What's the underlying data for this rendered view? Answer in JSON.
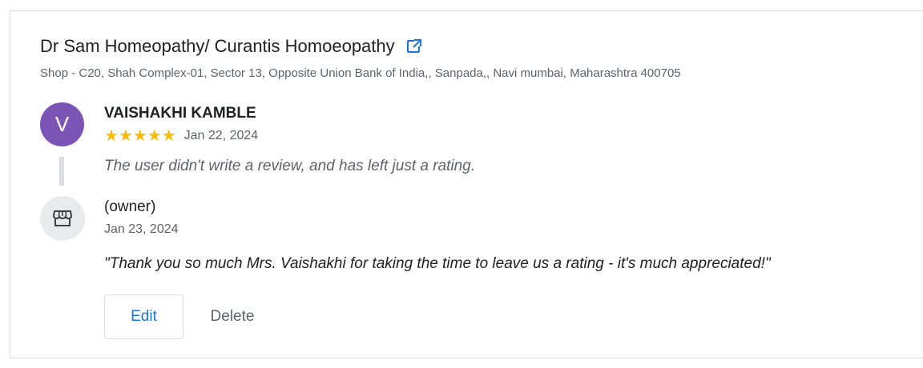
{
  "business": {
    "name": "Dr Sam Homeopathy/ Curantis Homoeopathy",
    "address": "Shop - C20, Shah Complex-01, Sector 13, Opposite Union Bank of India,, Sanpada,, Navi mumbai, Maharashtra 400705",
    "external_link_icon": "external-link-icon"
  },
  "review": {
    "avatar_letter": "V",
    "avatar_color": "#7c54b6",
    "reviewer_name": "VAISHAKHI KAMBLE",
    "rating": 5,
    "rating_max": 5,
    "stars": "★★★★★",
    "date": "Jan 22, 2024",
    "text": "The user didn't write a review, and has left just a rating."
  },
  "owner_reply": {
    "avatar_icon": "storefront-icon",
    "label": "(owner)",
    "date": "Jan 23, 2024",
    "text": "\"Thank you so much Mrs. Vaishakhi for taking the time to leave us a rating - it's much appreciated!\""
  },
  "actions": {
    "edit_label": "Edit",
    "delete_label": "Delete"
  },
  "colors": {
    "accent": "#1a73e8",
    "star": "#fbbc04"
  }
}
